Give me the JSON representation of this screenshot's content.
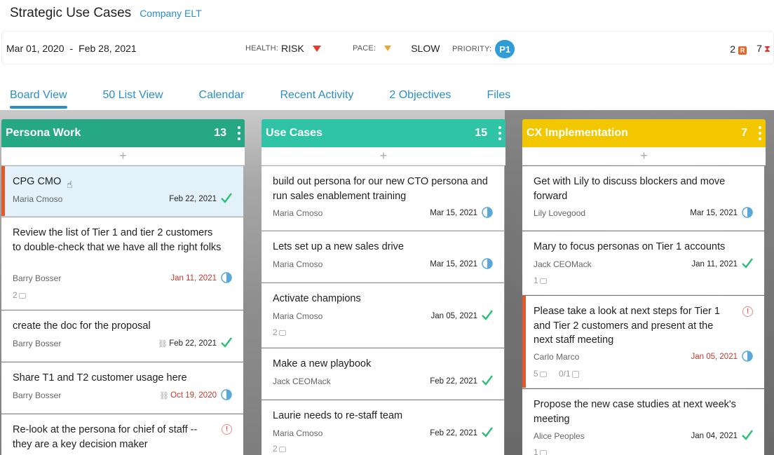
{
  "page": {
    "title": "Strategic Use Cases",
    "subtitle": "Company ELT"
  },
  "meta": {
    "start_date": "Mar 01, 2020",
    "date_separator": "-",
    "end_date": "Feb 28, 2021",
    "health_label": "HEALTH:",
    "health_value": "RISK",
    "pace_label": "PACE:",
    "pace_value": "SLOW",
    "priority_label": "PRIORITY:",
    "priority_value": "P1",
    "risk_count": "2",
    "risk_badge": "R",
    "overdue_count": "7",
    "colors": {
      "health": "#e53a2f",
      "pace": "#e8a82e",
      "priority": "#2f9ed8"
    }
  },
  "tabs": [
    {
      "label": "Board View",
      "active": true
    },
    {
      "label": "50 List View"
    },
    {
      "label": "Calendar"
    },
    {
      "label": "Recent Activity"
    },
    {
      "label": "2 Objectives"
    },
    {
      "label": "Files"
    }
  ],
  "columns": [
    {
      "name": "Persona Work",
      "count": "13",
      "color": "#27a884",
      "add": "+",
      "cards": [
        {
          "title": "CPG CMO",
          "person": "Maria Cmoso",
          "date": "Feb 22, 2021",
          "status": "done-icon"
        },
        {
          "title": "Review the list of Tier 1 and tier 2 customers to double-check that we have all the right folks",
          "person": "Barry Bosser",
          "date": "Jan 11, 2021",
          "status": "half-circle-icon",
          "comments": "2"
        },
        {
          "title": "create the doc for the proposal",
          "person": "Barry Bosser",
          "date": "Feb 22, 2021",
          "status": "done-icon"
        },
        {
          "title": "Share T1 and T2 customer usage here",
          "person": "Barry Bosser",
          "date": "Oct 19, 2020",
          "status": "half-circle-icon"
        },
        {
          "title": "Re-look at the persona for chief of staff -- they are a key decision maker",
          "status": "warning-icon"
        }
      ]
    },
    {
      "name": "Use Cases",
      "count": "15",
      "color": "#2ec4a5",
      "add": "+",
      "cards": [
        {
          "title": "build out persona for our new CTO persona and run sales enablement training",
          "person": "Maria Cmoso",
          "date": "Mar 15, 2021",
          "status": "half-circle-icon"
        },
        {
          "title": "Lets set up a new sales drive",
          "person": "Maria Cmoso",
          "date": "Mar 15, 2021",
          "status": "half-circle-icon"
        },
        {
          "title": "Activate champions",
          "person": "Maria Cmoso",
          "date": "Jan 05, 2021",
          "status": "done-icon",
          "comments": "2"
        },
        {
          "title": "Make a new playbook",
          "person": "Jack CEOMack",
          "date": "Feb 22, 2021",
          "status": "done-icon"
        },
        {
          "title": "Laurie needs to re-staff team",
          "person": "Maria Cmoso",
          "date": "Feb 22, 2021",
          "status": "done-icon",
          "comments": "2"
        }
      ]
    },
    {
      "name": "CX Implementation",
      "count": "7",
      "color": "#f2c700",
      "add": "+",
      "cards": [
        {
          "title": "Get with Lily to discuss blockers and move forward",
          "person": "Lily Lovegood",
          "date": "Mar 15, 2021",
          "status": "half-circle-icon"
        },
        {
          "title": "Mary to focus personas on Tier 1 accounts",
          "person": "Jack CEOMack",
          "date": "Jan 11, 2021",
          "status": "done-icon",
          "comments": "1"
        },
        {
          "title": "Please take a look at next steps for Tier 1 and Tier 2 customers and present at the next staff meeting",
          "person": "Carlo Marco",
          "date": "Jan 05, 2021",
          "status": "half-circle-icon",
          "comments": "5",
          "checklist": "0/1"
        },
        {
          "title": "Propose the new case studies at next week's meeting",
          "person": "Alice Peoples",
          "date": "Jan 04, 2021",
          "status": "done-icon",
          "comments": "1"
        }
      ]
    }
  ]
}
